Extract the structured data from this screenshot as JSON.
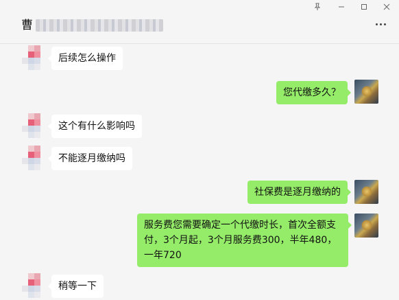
{
  "window": {
    "pin_icon": "pin-icon",
    "minimize_icon": "minimize-icon",
    "maximize_icon": "maximize-icon",
    "close_icon": "close-icon"
  },
  "header": {
    "title": "曹",
    "more_icon": "more-options-icon"
  },
  "colors": {
    "background": "#f5f5f5",
    "incoming_bubble": "#ffffff",
    "outgoing_bubble": "#95ec69"
  },
  "messages": [
    {
      "side": "left",
      "text": "后续怎么操作"
    },
    {
      "side": "right",
      "text": "您代缴多久？"
    },
    {
      "side": "left",
      "text": "这个有什么影响吗"
    },
    {
      "side": "left",
      "text": "不能逐月缴纳吗"
    },
    {
      "side": "right",
      "text": "社保费是逐月缴纳的"
    },
    {
      "side": "right",
      "text": "服务费您需要确定一个代缴时长，首次全额支付，3个月起，3个月服务费300，半年480，一年720"
    },
    {
      "side": "left",
      "text": "稍等一下"
    }
  ]
}
